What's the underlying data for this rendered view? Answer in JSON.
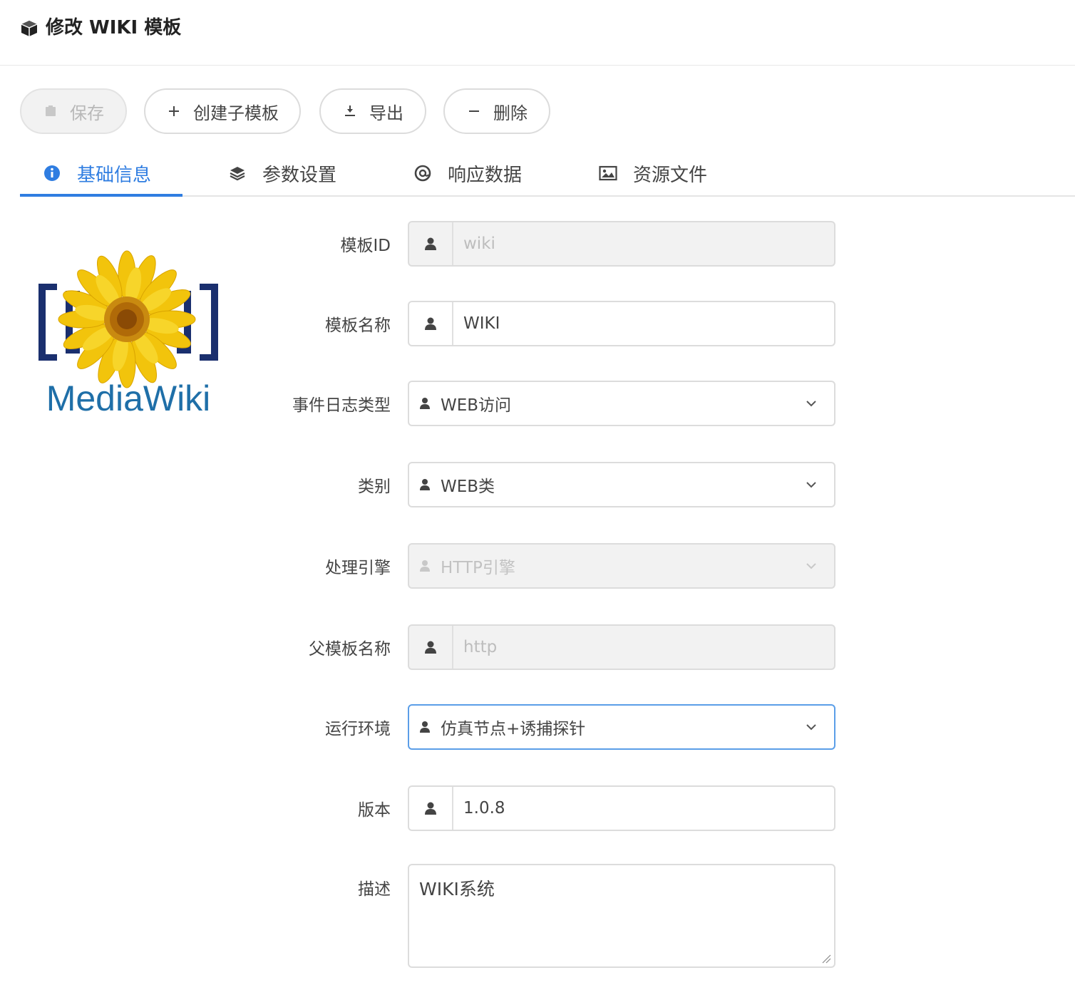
{
  "header": {
    "title": "修改 WIKI 模板"
  },
  "toolbar": {
    "save_label": "保存",
    "create_child_label": "创建子模板",
    "export_label": "导出",
    "delete_label": "删除"
  },
  "tabs": [
    {
      "label": "基础信息",
      "icon": "info-icon",
      "active": true
    },
    {
      "label": "参数设置",
      "icon": "layers-icon",
      "active": false
    },
    {
      "label": "响应数据",
      "icon": "at-icon",
      "active": false
    },
    {
      "label": "资源文件",
      "icon": "image-icon",
      "active": false
    }
  ],
  "logo": {
    "text": "MediaWiki"
  },
  "form": {
    "template_id": {
      "label": "模板ID",
      "value": "wiki"
    },
    "template_name": {
      "label": "模板名称",
      "value": "WIKI"
    },
    "event_log_type": {
      "label": "事件日志类型",
      "value": "WEB访问"
    },
    "category": {
      "label": "类别",
      "value": "WEB类"
    },
    "engine": {
      "label": "处理引擎",
      "value": "HTTP引擎"
    },
    "parent_name": {
      "label": "父模板名称",
      "value": "http"
    },
    "runtime_env": {
      "label": "运行环境",
      "value": "仿真节点+诱捕探针"
    },
    "version": {
      "label": "版本",
      "value": "1.0.8"
    },
    "description": {
      "label": "描述",
      "value": "WIKI系统"
    }
  },
  "colors": {
    "accent": "#2f7de1",
    "focus_border": "#5b9ee8",
    "logo_text": "#1f6fa8",
    "logo_bracket": "#1a2f6e"
  }
}
